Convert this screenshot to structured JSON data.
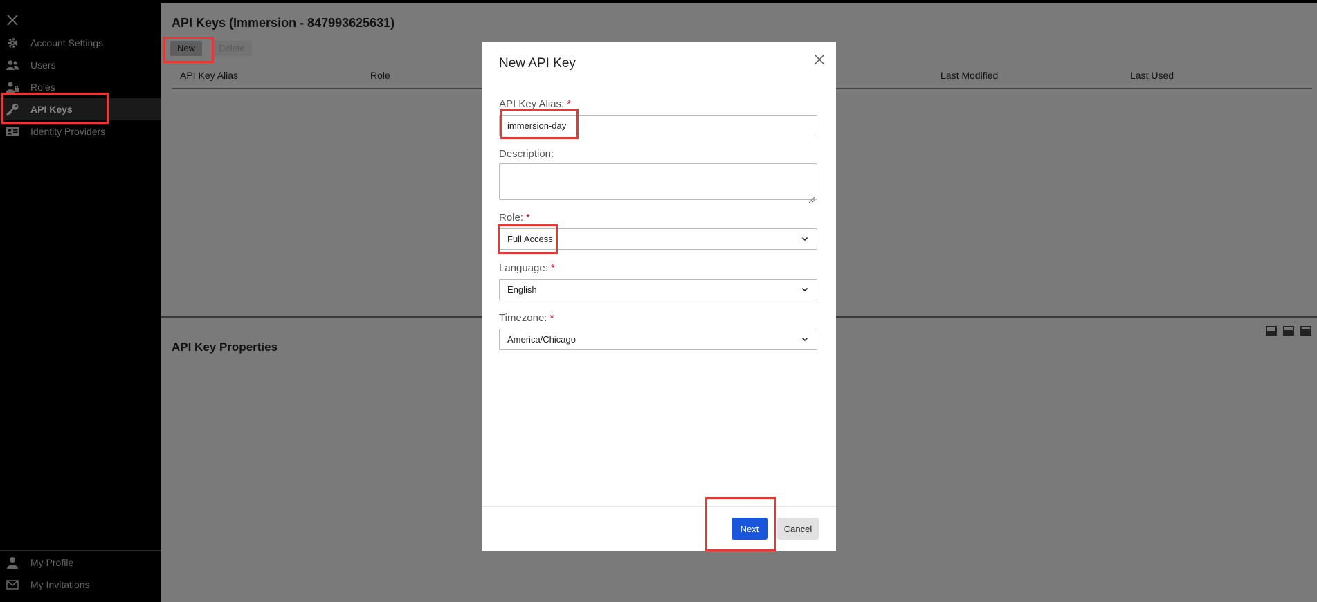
{
  "sidebar": {
    "items": [
      {
        "label": "Account Settings",
        "icon": "gear-icon"
      },
      {
        "label": "Users",
        "icon": "users-icon"
      },
      {
        "label": "Roles",
        "icon": "roles-icon"
      },
      {
        "label": "API Keys",
        "icon": "key-icon",
        "active": true
      },
      {
        "label": "Identity Providers",
        "icon": "id-card-icon"
      }
    ],
    "bottom_items": [
      {
        "label": "My Profile",
        "icon": "user-icon"
      },
      {
        "label": "My Invitations",
        "icon": "envelope-icon"
      }
    ]
  },
  "main": {
    "title": "API Keys (Immersion - 847993625631)",
    "toolbar": {
      "new_label": "New",
      "delete_label": "Delete"
    },
    "columns": [
      "API Key Alias",
      "Role",
      "Last Modified",
      "Last Used"
    ],
    "properties_title": "API Key Properties"
  },
  "modal": {
    "title": "New API Key",
    "fields": {
      "alias": {
        "label": "API Key Alias:",
        "required": "*",
        "value": "immersion-day"
      },
      "description": {
        "label": "Description:",
        "value": ""
      },
      "role": {
        "label": "Role:",
        "required": "*",
        "value": "Full Access"
      },
      "language": {
        "label": "Language:",
        "required": "*",
        "value": "English"
      },
      "timezone": {
        "label": "Timezone:",
        "required": "*",
        "value": "America/Chicago"
      }
    },
    "next_label": "Next",
    "cancel_label": "Cancel"
  },
  "colors": {
    "primary_button": "#1a56db",
    "required_marker": "#d0021b",
    "highlight_annotation": "#e53935"
  }
}
